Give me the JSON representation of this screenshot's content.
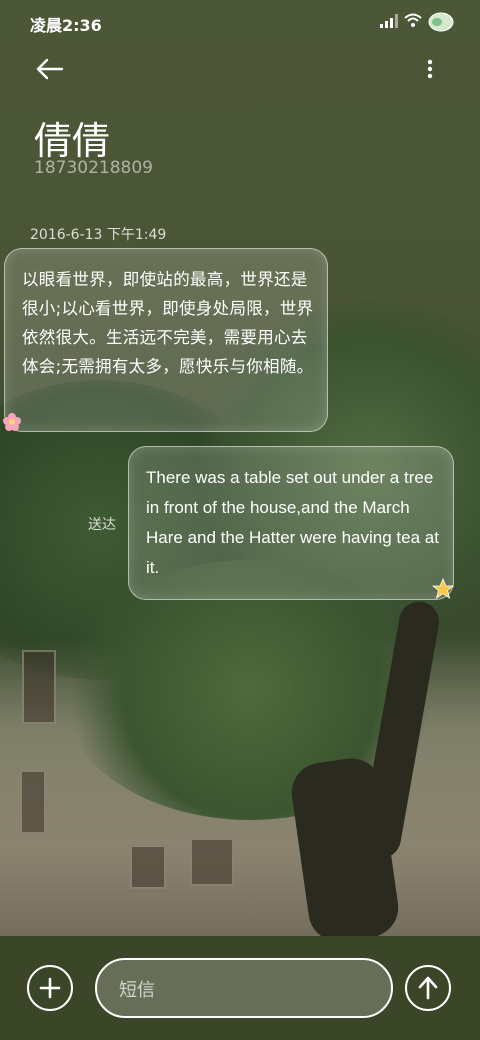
{
  "status_bar": {
    "time": "凌晨2:36"
  },
  "header": {
    "contact_name": "倩倩",
    "contact_number": "18730218809",
    "back_icon": "arrow-left-icon",
    "more_icon": "more-vertical-icon"
  },
  "conversation": {
    "timestamp": "2016-6-13 下午1:49",
    "messages": [
      {
        "direction": "incoming",
        "text": "以眼看世界，即使站的最高，世界还是很小;以心看世界，即使身处局限，世界依然很大。生活远不完美，需要用心去体会;无需拥有太多，愿快乐与你相随。",
        "decoration_icon": "flower-icon"
      },
      {
        "direction": "outgoing",
        "text": "There was a table set out under a tree in front of the house,and the March Hare and the Hatter were having tea at it.",
        "status": "送达",
        "decoration_icon": "star-icon"
      }
    ]
  },
  "composer": {
    "placeholder": "短信",
    "value": ""
  },
  "colors": {
    "background": "#4a5534",
    "input_bar": "#3b4628",
    "text": "#ffffff"
  }
}
